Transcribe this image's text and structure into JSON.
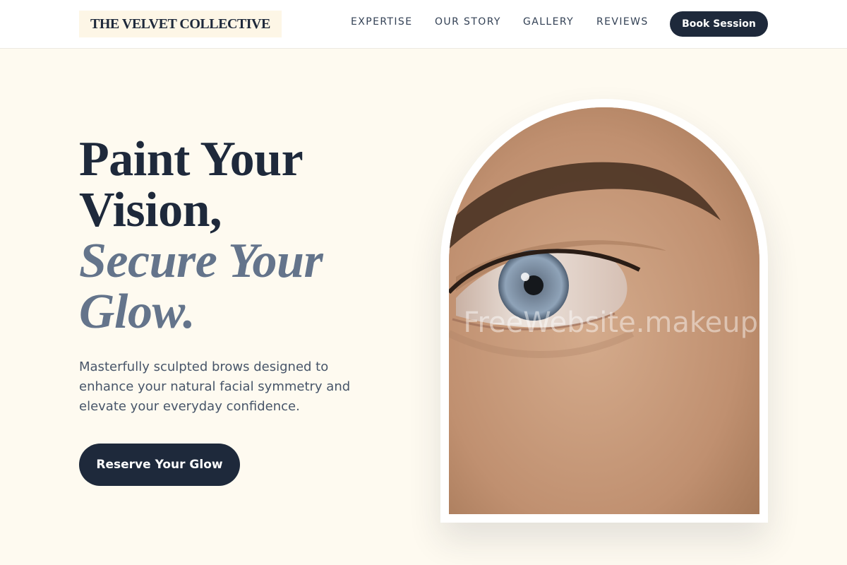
{
  "header": {
    "logo": "THE VELVET COLLECTIVE",
    "nav": [
      "EXPERTISE",
      "OUR STORY",
      "GALLERY",
      "REVIEWS"
    ],
    "book_label": "Book Session"
  },
  "hero": {
    "headline_line1": "Paint Your",
    "headline_line2": "Vision,",
    "headline_accent1": "Secure Your",
    "headline_accent2": "Glow.",
    "subtext": "Masterfully sculpted brows designed to enhance your natural facial symmetry and elevate your everyday confidence.",
    "cta_label": "Reserve Your Glow"
  },
  "image": {
    "watermark": "FreeWebsite.makeup"
  },
  "colors": {
    "background": "#fefaf0",
    "navy": "#1e293b",
    "slate_accent": "#64748b"
  }
}
